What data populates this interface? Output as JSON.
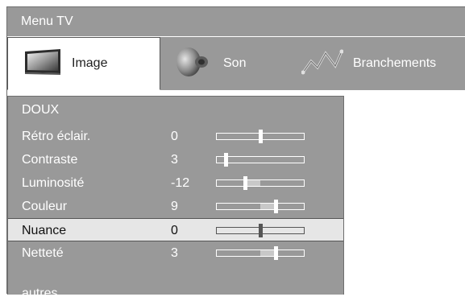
{
  "window": {
    "title": "Menu TV"
  },
  "tabs": [
    {
      "label": "Image",
      "icon": "tv-screen-icon",
      "active": true
    },
    {
      "label": "Son",
      "icon": "speaker-icon",
      "active": false
    },
    {
      "label": "Branchements",
      "icon": "cable-icon",
      "active": false
    }
  ],
  "menu": {
    "mode": "DOUX",
    "items": [
      {
        "label": "Rétro éclair.",
        "value": "0",
        "level": 0.5,
        "fill_from": 0.5
      },
      {
        "label": "Contraste",
        "value": "3",
        "level": 0.1,
        "fill_from": 0.1
      },
      {
        "label": "Luminosité",
        "value": "-12",
        "level": 0.32,
        "fill_from": 0.5
      },
      {
        "label": "Couleur",
        "value": "9",
        "level": 0.68,
        "fill_from": 0.5
      },
      {
        "label": "Nuance",
        "value": "0",
        "level": 0.5,
        "fill_from": 0.5,
        "selected": true
      },
      {
        "label": "Netteté",
        "value": "3",
        "level": 0.68,
        "fill_from": 0.5
      }
    ],
    "more_label": "autres..."
  },
  "colors": {
    "background": "#999999",
    "text": "#ffffff",
    "selected_row": "#e6e6e6"
  }
}
